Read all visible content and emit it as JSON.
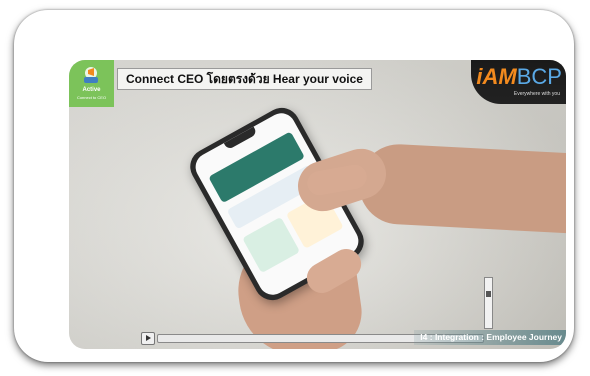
{
  "video": {
    "title": "Connect CEO โดยตรงด้วย Hear your voice",
    "thumb": {
      "name": "Active",
      "sub": "Connect to CEO"
    },
    "brand": {
      "prefix": "i",
      "mid": "AM",
      "suffix": "BCP",
      "tagline": "Everywhere with you"
    },
    "caption": "I4 : Integration : Employee Journey",
    "volume": 0.7,
    "progress": 0.0
  },
  "colors": {
    "thumb": "#7cc35a",
    "brand_orange": "#f28a1e",
    "brand_blue": "#5aa9e6"
  },
  "icons": [
    "play-icon",
    "megaphone-icon"
  ]
}
